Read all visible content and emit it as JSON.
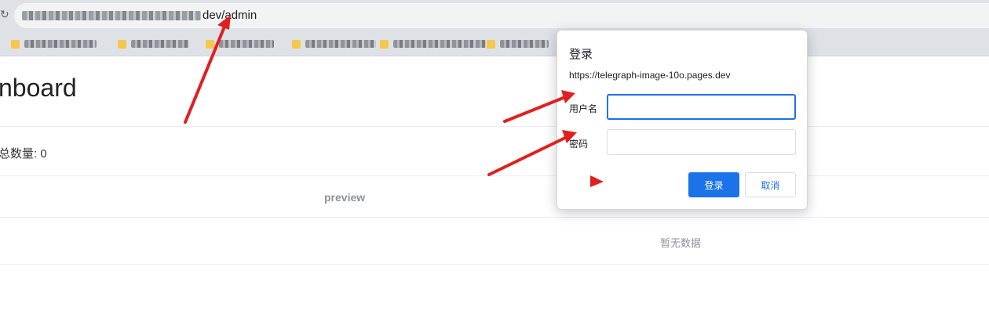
{
  "browser": {
    "url_visible": "dev/admin"
  },
  "page": {
    "title": "nboard",
    "count_label": "总数量: 0",
    "table": {
      "column_header": "preview",
      "empty_text": "暂无数据"
    }
  },
  "dialog": {
    "title": "登录",
    "origin": "https://telegraph-image-10o.pages.dev",
    "username_label": "用户名",
    "password_label": "密码",
    "username_value": "",
    "password_value": "",
    "login_button": "登录",
    "cancel_button": "取消"
  },
  "colors": {
    "accent": "#1a73e8",
    "annotation_arrow": "#e02020"
  }
}
